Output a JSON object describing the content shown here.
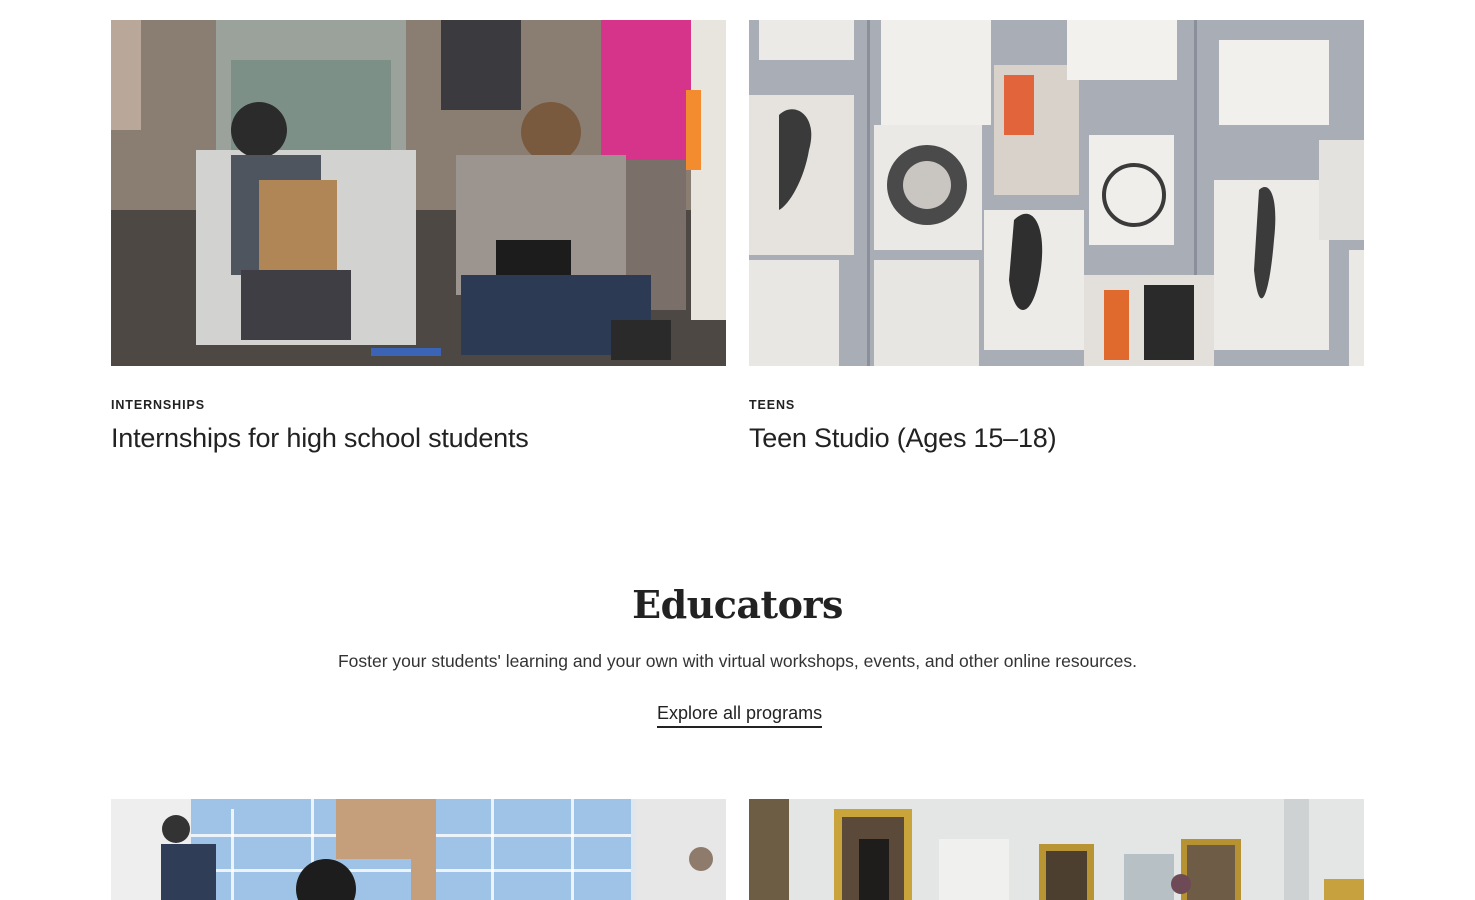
{
  "cards_top": [
    {
      "eyebrow": "INTERNSHIPS",
      "title": "Internships for high school students"
    },
    {
      "eyebrow": "TEENS",
      "title": "Teen Studio (Ages 15–18)"
    }
  ],
  "educators": {
    "heading": "Educators",
    "description": "Foster your students' learning and your own with virtual workshops, events, and other online resources.",
    "link_label": "Explore all programs"
  }
}
